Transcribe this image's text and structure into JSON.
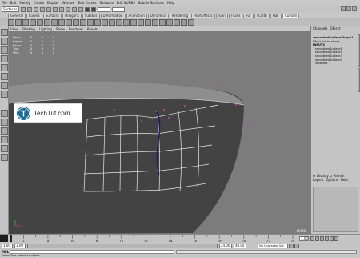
{
  "menubar": {
    "items": [
      "File",
      "Edit",
      "Modify",
      "Create",
      "Display",
      "Window",
      "Edit Curves",
      "Surfaces",
      "Edit NURBS",
      "Subdiv Surfaces",
      "Help"
    ]
  },
  "statusline": {
    "mode": "Surfaces"
  },
  "shelf": {
    "tabs": [
      "General",
      "Curves",
      "Surfaces",
      "Polygons",
      "Subdivs",
      "Deformation",
      "Animation",
      "Dynamics",
      "Rendering",
      "PaintEffects",
      "Toon",
      "Fluids",
      "Fur",
      "nCloth",
      "Hair",
      "Custom"
    ],
    "active_tab": 15
  },
  "viewport": {
    "menu": [
      "View",
      "Shading",
      "Lighting",
      "Show",
      "Renderer",
      "Panels"
    ],
    "hud": [
      {
        "label": "Verts:",
        "values": [
          "0",
          "0",
          "0"
        ]
      },
      {
        "label": "Edges:",
        "values": [
          "0",
          "0",
          "0"
        ]
      },
      {
        "label": "Faces:",
        "values": [
          "0",
          "0",
          "0"
        ]
      },
      {
        "label": "Tris:",
        "values": [
          "0",
          "0",
          "0"
        ]
      },
      {
        "label": "UVs:",
        "values": [
          "0",
          "0",
          "0"
        ]
      }
    ],
    "camera_label": "persp",
    "surface_color": "#434343",
    "background_color": "#7c7c7c"
  },
  "badge": {
    "text": "TechTut.com",
    "logo_color": "#1d6e98"
  },
  "channel_box": {
    "tabs": [
      "Channels",
      "Object"
    ],
    "items": [
      {
        "text": "smoothedSurfaceShape1",
        "style": "node"
      },
      {
        "text": "EPs (click to show)",
        "style": "plain"
      },
      {
        "text": "INPUTS",
        "style": "node"
      },
      {
        "text": "smoothedSurface1",
        "style": "indent"
      },
      {
        "text": "smoothedSurface2",
        "style": "indent"
      },
      {
        "text": "smoothedSurface3",
        "style": "indent"
      },
      {
        "text": "smoothedSurface4",
        "style": "indent"
      },
      {
        "text": "revolve1",
        "style": "indent"
      }
    ]
  },
  "layers": {
    "options": [
      "Display",
      "Render"
    ],
    "menu": [
      "Layers",
      "Options",
      "Help"
    ]
  },
  "timeline": {
    "ticks": [
      "1",
      "2",
      "4",
      "6",
      "8",
      "10",
      "12",
      "14",
      "16",
      "18",
      "20",
      "22",
      "24"
    ],
    "current_frame": "1.00"
  },
  "range": {
    "start": "1.00",
    "start_inner": "1.00",
    "end_inner": "24.00",
    "end": "48.00",
    "character_set": "No Character Set"
  },
  "command": {
    "label": "MEL"
  },
  "help": {
    "text": "Select Tool: select an object"
  }
}
